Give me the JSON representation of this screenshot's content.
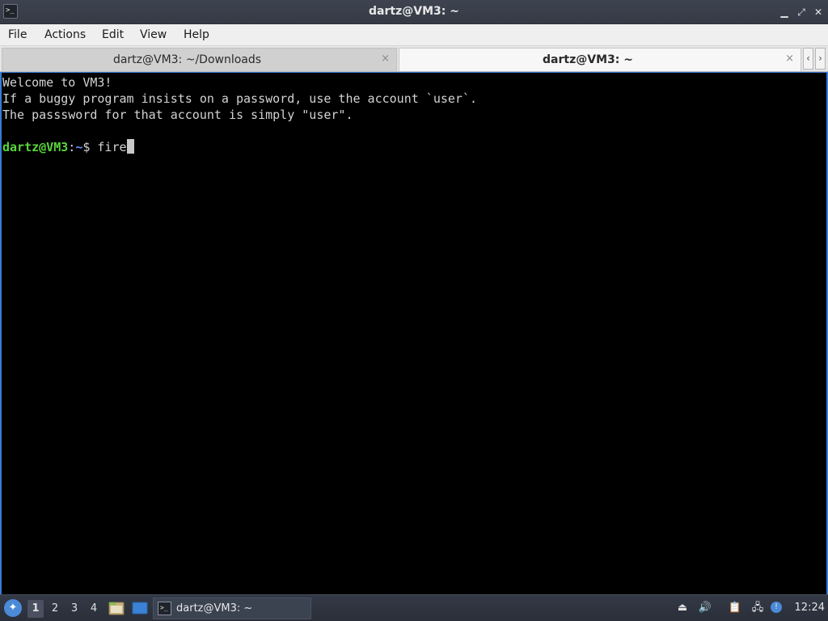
{
  "window": {
    "title": "dartz@VM3: ~",
    "minimize_glyph": "▁",
    "maximize_glyph": "⤢",
    "close_glyph": "✕"
  },
  "menubar": {
    "items": [
      "File",
      "Actions",
      "Edit",
      "View",
      "Help"
    ]
  },
  "tabs": [
    {
      "label": "dartz@VM3: ~/Downloads",
      "active": false,
      "close_glyph": "×"
    },
    {
      "label": "dartz@VM3: ~",
      "active": true,
      "close_glyph": "×"
    }
  ],
  "tab_scroll": {
    "left_glyph": "‹",
    "right_glyph": "›"
  },
  "terminal": {
    "lines": [
      "Welcome to VM3!",
      "If a buggy program insists on a password, use the account `user`.",
      "The passsword for that account is simply \"user\"."
    ],
    "prompt": {
      "user_host": "dartz@VM3",
      "separator": ":",
      "path": "~",
      "symbol": "$ ",
      "input": "fire"
    },
    "colors": {
      "background": "#000000",
      "text": "#d3d3d3",
      "prompt_user": "#5ad53c",
      "prompt_path": "#6e8cff"
    }
  },
  "taskbar": {
    "start_icon": "lxqt-start-icon",
    "start_glyph": "✦",
    "workspaces": [
      "1",
      "2",
      "3",
      "4"
    ],
    "active_workspace": "1",
    "launchers": [
      "file-manager-icon",
      "desktop-icon"
    ],
    "task": {
      "label": "dartz@VM3: ~",
      "icon": "terminal-icon"
    },
    "tray": {
      "items": [
        "eject-icon",
        "volume-icon",
        "clipboard-icon",
        "network-icon",
        "notification-icon"
      ],
      "glyphs": [
        "⏏",
        "🔊",
        "📋",
        "🖧",
        "!"
      ]
    },
    "clock": "12:24"
  },
  "icons": {
    "app_icon_glyph": ">_",
    "task_icon_glyph": ">_"
  }
}
